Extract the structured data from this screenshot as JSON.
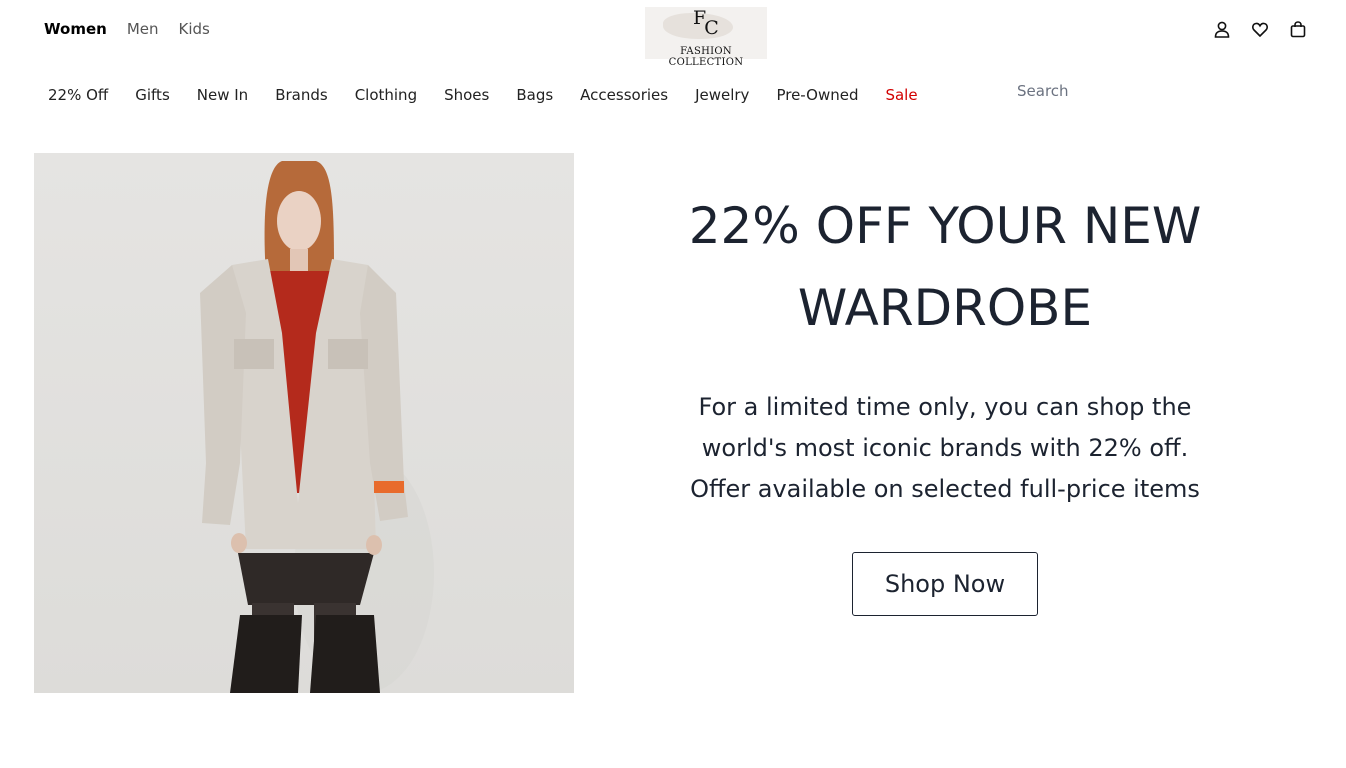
{
  "header": {
    "gender_tabs": [
      "Women",
      "Men",
      "Kids"
    ],
    "logo": {
      "monogram_f": "F",
      "monogram_c": "C",
      "caption": "FASHION COLLECTION"
    },
    "icons": [
      "account-icon",
      "wishlist-heart-icon",
      "shopping-bag-icon"
    ]
  },
  "nav": {
    "categories": [
      "22% Off",
      "Gifts",
      "New In",
      "Brands",
      "Clothing",
      "Shoes",
      "Bags",
      "Accessories",
      "Jewelry",
      "Pre-Owned",
      "Sale"
    ],
    "sale_color": "#d20000"
  },
  "search": {
    "placeholder": "Search",
    "value": ""
  },
  "hero": {
    "headline": "22% OFF YOUR NEW WARDROBE",
    "body": "For a limited time only, you can shop the world's most iconic brands with 22% off. Offer available on selected full-price items",
    "cta": "Shop Now"
  },
  "colors": {
    "text": "#1c2330",
    "background": "#ffffff"
  }
}
